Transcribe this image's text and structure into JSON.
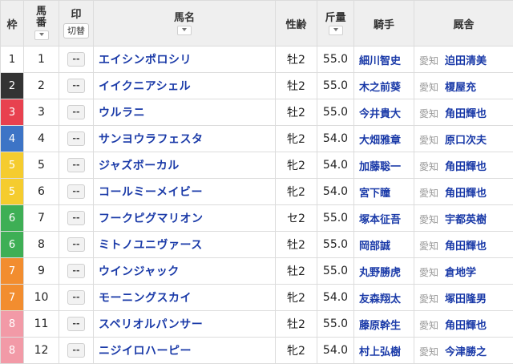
{
  "header": {
    "waku": "枠",
    "umaban": "馬番",
    "mark": "印",
    "mark_toggle": "切替",
    "name": "馬名",
    "sex_age": "性齢",
    "weight": "斤量",
    "jockey": "騎手",
    "stable": "厩舎"
  },
  "rows": [
    {
      "waku": "1",
      "umaban": "1",
      "mark": "--",
      "name": "エイシンポロシリ",
      "sex_age": "牡2",
      "weight": "55.0",
      "jockey": "細川智史",
      "region": "愛知",
      "trainer": "迫田清美"
    },
    {
      "waku": "2",
      "umaban": "2",
      "mark": "--",
      "name": "イイクニアシェル",
      "sex_age": "牡2",
      "weight": "55.0",
      "jockey": "木之前葵",
      "region": "愛知",
      "trainer": "榎屋充"
    },
    {
      "waku": "3",
      "umaban": "3",
      "mark": "--",
      "name": "ウルラニ",
      "sex_age": "牡2",
      "weight": "55.0",
      "jockey": "今井貴大",
      "region": "愛知",
      "trainer": "角田輝也"
    },
    {
      "waku": "4",
      "umaban": "4",
      "mark": "--",
      "name": "サンヨウラフェスタ",
      "sex_age": "牝2",
      "weight": "54.0",
      "jockey": "大畑雅章",
      "region": "愛知",
      "trainer": "原口次夫"
    },
    {
      "waku": "5",
      "umaban": "5",
      "mark": "--",
      "name": "ジャズボーカル",
      "sex_age": "牝2",
      "weight": "54.0",
      "jockey": "加藤聡一",
      "region": "愛知",
      "trainer": "角田輝也"
    },
    {
      "waku": "5",
      "umaban": "6",
      "mark": "--",
      "name": "コールミーメイビー",
      "sex_age": "牝2",
      "weight": "54.0",
      "jockey": "宮下瞳",
      "region": "愛知",
      "trainer": "角田輝也"
    },
    {
      "waku": "6",
      "umaban": "7",
      "mark": "--",
      "name": "フークピグマリオン",
      "sex_age": "セ2",
      "weight": "55.0",
      "jockey": "塚本征吾",
      "region": "愛知",
      "trainer": "宇都英樹"
    },
    {
      "waku": "6",
      "umaban": "8",
      "mark": "--",
      "name": "ミトノユニヴァース",
      "sex_age": "牡2",
      "weight": "55.0",
      "jockey": "岡部誠",
      "region": "愛知",
      "trainer": "角田輝也"
    },
    {
      "waku": "7",
      "umaban": "9",
      "mark": "--",
      "name": "ウインジャック",
      "sex_age": "牡2",
      "weight": "55.0",
      "jockey": "丸野勝虎",
      "region": "愛知",
      "trainer": "倉地学"
    },
    {
      "waku": "7",
      "umaban": "10",
      "mark": "--",
      "name": "モーニングスカイ",
      "sex_age": "牝2",
      "weight": "54.0",
      "jockey": "友森翔太",
      "region": "愛知",
      "trainer": "塚田隆男"
    },
    {
      "waku": "8",
      "umaban": "11",
      "mark": "--",
      "name": "スペリオルパンサー",
      "sex_age": "牡2",
      "weight": "55.0",
      "jockey": "藤原幹生",
      "region": "愛知",
      "trainer": "角田輝也"
    },
    {
      "waku": "8",
      "umaban": "12",
      "mark": "--",
      "name": "ニジイロハーピー",
      "sex_age": "牝2",
      "weight": "54.0",
      "jockey": "村上弘樹",
      "region": "愛知",
      "trainer": "今津勝之"
    }
  ]
}
